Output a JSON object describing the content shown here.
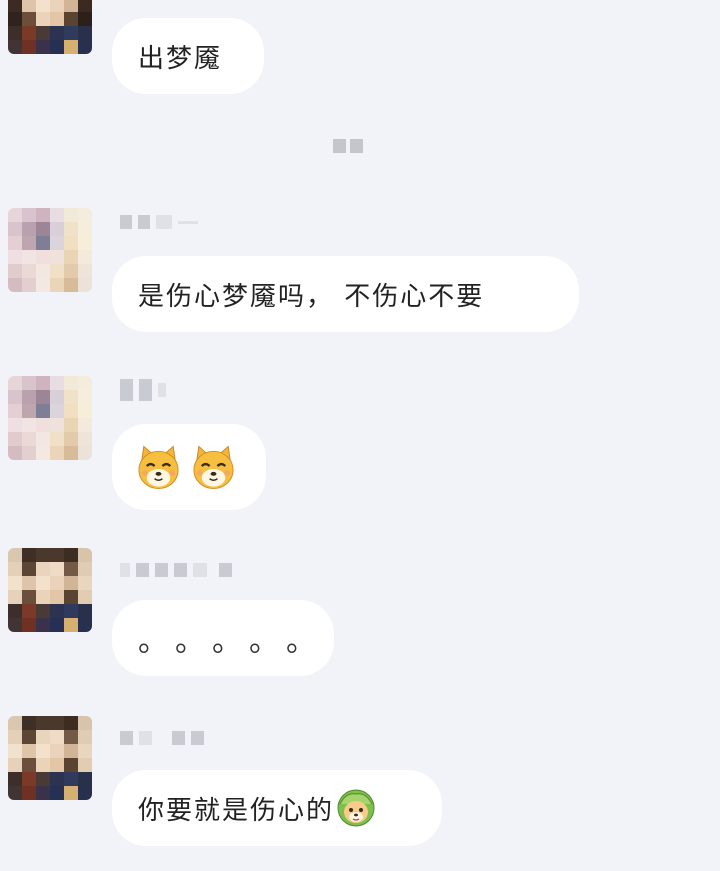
{
  "messages": [
    {
      "text": "出梦魇"
    },
    {
      "text": "是伤心梦魇吗， 不伤心不要"
    },
    {
      "emojis": [
        "shiba-emoji",
        "shiba-emoji"
      ]
    },
    {
      "text": "。。。。。"
    },
    {
      "text": "你要就是伤心的",
      "trailing_emoji": "shiba-cabbage-emoji"
    }
  ],
  "colors": {
    "background": "#f2f3f8",
    "bubble": "#ffffff",
    "blurred_name": "#c9cbd2"
  }
}
